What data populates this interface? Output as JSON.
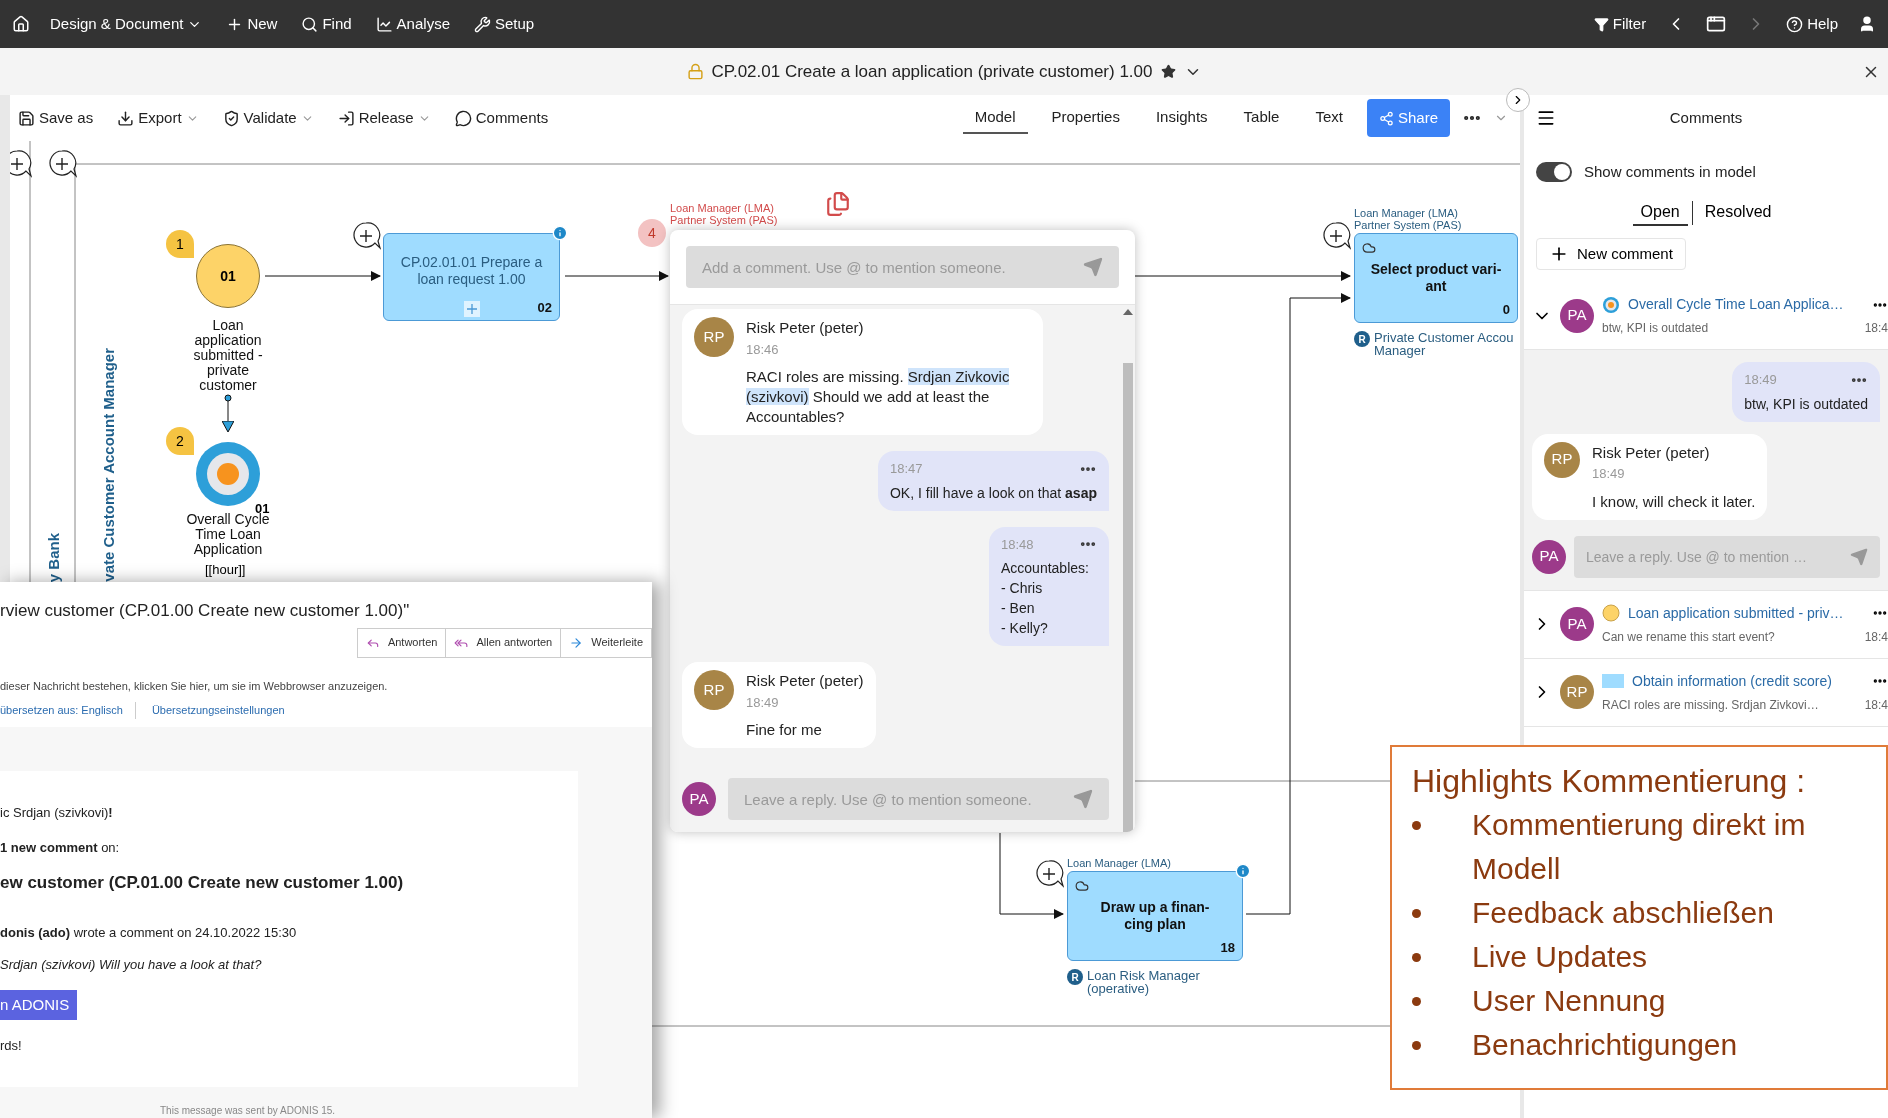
{
  "top_bar": {
    "menu": [
      {
        "label": "Design & Document",
        "dropdown": true
      },
      {
        "label": "New",
        "dropdown": false
      },
      {
        "label": "Find",
        "dropdown": false
      },
      {
        "label": "Analyse",
        "dropdown": false
      },
      {
        "label": "Setup",
        "dropdown": false
      }
    ],
    "filter": "Filter",
    "help": "Help"
  },
  "title_bar": {
    "title": "CP.02.01 Create a loan application (private customer) 1.00"
  },
  "toolbar": {
    "actions": [
      {
        "label": "Save as",
        "dropdown": false
      },
      {
        "label": "Export",
        "dropdown": true
      },
      {
        "label": "Validate",
        "dropdown": true
      },
      {
        "label": "Release",
        "dropdown": true
      },
      {
        "label": "Comments",
        "dropdown": false
      }
    ],
    "views": [
      {
        "label": "Model",
        "selected": true
      },
      {
        "label": "Properties",
        "selected": false
      },
      {
        "label": "Insights",
        "selected": false
      },
      {
        "label": "Table",
        "selected": false
      },
      {
        "label": "Text",
        "selected": false
      }
    ],
    "share": "Share"
  },
  "diagram": {
    "lanes": [
      "y Bank",
      "vate Customer Account Manager"
    ],
    "start_event": {
      "badge": "1",
      "number": "01",
      "label": "Loan application submitted - private customer"
    },
    "kpi": {
      "badge": "2",
      "number": "01",
      "label": "Overall Cycle Time Loan Application",
      "unit": "[[hour]]"
    },
    "hidden_task": {
      "badge": "4",
      "performers": [
        "Loan Manager (LMA)",
        "Partner System (PAS)"
      ]
    },
    "tasks": [
      {
        "kind": "subprocess",
        "lines": [
          "CP.02.01.01 Prepare a",
          "loan request 1.00"
        ],
        "number": "02"
      },
      {
        "kind": "task",
        "lines": [
          "Select product vari-",
          "ant"
        ],
        "number": "0",
        "performers": [
          "Loan Manager (LMA)",
          "Partner System (PAS)"
        ],
        "role_icon": "R",
        "role": [
          "Private Customer Accou",
          "Manager"
        ]
      },
      {
        "kind": "task",
        "lines": [
          "Draw up a finan-",
          "cing plan"
        ],
        "number": "18",
        "performers": [
          "Loan Manager (LMA)"
        ],
        "role_icon": "R",
        "role": [
          "Loan Risk Manager",
          "(operative)"
        ]
      }
    ]
  },
  "chat_popup": {
    "placeholder": "Add a comment. Use @ to mention someone.",
    "messages": [
      {
        "kind": "received",
        "author": "Risk Peter (peter)",
        "initials": "RP",
        "color": "#a88547",
        "time": "18:46",
        "text": "RACI roles are missing. ",
        "mention": "Srdjan Zivkovic (szivkovi)",
        "text_after": " Should we add at least the Accountables?"
      },
      {
        "kind": "sent",
        "time": "18:47",
        "text": "OK, I fill have a look on that **asap**"
      },
      {
        "kind": "sent",
        "time": "18:48",
        "text": "Accountables:\n- Chris\n- Ben\n- Kelly?"
      },
      {
        "kind": "received",
        "author": "Risk Peter (peter)",
        "initials": "RP",
        "color": "#a88547",
        "time": "18:49",
        "text": "Fine for me"
      }
    ],
    "reply": {
      "initials": "PA",
      "color": "#9c3a8a",
      "placeholder": "Leave a reply. Use @ to mention someone."
    }
  },
  "email": {
    "subject": "rview customer (CP.01.00 Create new customer 1.00)\"",
    "actions": [
      "Antworten",
      "Allen antworten",
      "Weiterleite"
    ],
    "notice": "dieser Nachricht bestehen, klicken Sie hier, um sie im Webbrowser anzuzeigen.",
    "links": [
      "übersetzen aus: Englisch",
      "Übersetzungseinstellungen"
    ],
    "greeting": "ic Srdjan (szivkovi)**!**",
    "intro": "**1 new comment** on:",
    "heading": "ew customer (CP.01.00 Create new customer 1.00)",
    "byline": "**donis (ado)** wrote a comment on 24.10.2022 15:30",
    "quote": "Srdjan (szivkovi) Will you have a look at that?",
    "button": "n ADONIS",
    "closing": "rds!",
    "footer": "This message was sent by ADONIS 15."
  },
  "comments_panel": {
    "title": "Comments",
    "toggle": {
      "label": "Show comments in model",
      "on": true
    },
    "tabs": [
      {
        "label": "Open",
        "selected": true
      },
      {
        "label": "Resolved",
        "selected": false
      }
    ],
    "new_comment": "New comment",
    "threads": [
      {
        "expanded": true,
        "initials": "PA",
        "color": "#9c3a8a",
        "kind": "kpi",
        "title": "Overall Cycle Time Loan Applica…",
        "preview": "btw, KPI is outdated",
        "time": "18:4",
        "replies": [
          {
            "kind": "sent",
            "time": "18:49",
            "text": "btw, KPI is outdated"
          },
          {
            "kind": "received",
            "author": "Risk Peter (peter)",
            "initials": "RP",
            "color": "#a88547",
            "time": "18:49",
            "text": "I know, will check it later."
          }
        ],
        "reply": {
          "initials": "PA",
          "color": "#9c3a8a",
          "placeholder": "Leave a reply. Use @ to mention …"
        }
      },
      {
        "expanded": false,
        "initials": "PA",
        "color": "#9c3a8a",
        "kind": "event",
        "title": "Loan application submitted - priv…",
        "preview": "Can we rename this start event?",
        "time": "18:4"
      },
      {
        "expanded": false,
        "initials": "RP",
        "color": "#a88547",
        "kind": "task",
        "title": "Obtain information (credit score)",
        "preview": "RACI roles are missing. Srdjan Zivkovi…",
        "time": "18:4"
      }
    ]
  },
  "highlights": {
    "title": "Highlights Kommentierung :",
    "bullets": [
      "Kommentierung direkt im Modell",
      "Feedback abschließen",
      "Live Updates",
      "User Nennung",
      "Benachrichtigungen"
    ]
  }
}
